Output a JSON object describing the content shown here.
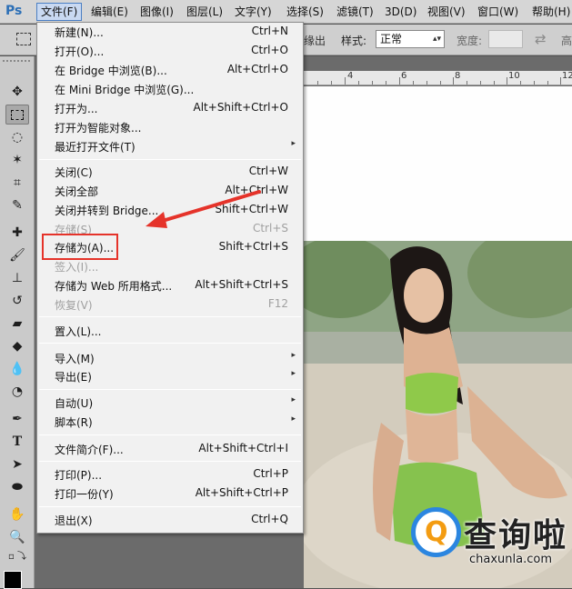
{
  "app": {
    "logo": "Ps"
  },
  "menubar": {
    "items": [
      "文件(F)",
      "编辑(E)",
      "图像(I)",
      "图层(L)",
      "文字(Y)",
      "选择(S)",
      "滤镜(T)",
      "3D(D)",
      "视图(V)",
      "窗口(W)",
      "帮助(H)"
    ]
  },
  "options": {
    "edge_text": "缘出",
    "style_label": "样式:",
    "style_value": "正常",
    "width_label": "宽度:",
    "height_label": "高"
  },
  "ruler": {
    "numbers": [
      "4",
      "6",
      "8",
      "10",
      "12"
    ]
  },
  "file_menu": {
    "items": [
      {
        "label": "新建(N)...",
        "shortcut": "Ctrl+N"
      },
      {
        "label": "打开(O)...",
        "shortcut": "Ctrl+O"
      },
      {
        "label": "在 Bridge 中浏览(B)...",
        "shortcut": "Alt+Ctrl+O"
      },
      {
        "label": "在 Mini Bridge 中浏览(G)...",
        "shortcut": ""
      },
      {
        "label": "打开为...",
        "shortcut": "Alt+Shift+Ctrl+O"
      },
      {
        "label": "打开为智能对象...",
        "shortcut": ""
      },
      {
        "label": "最近打开文件(T)",
        "shortcut": ""
      },
      {
        "label": "关闭(C)",
        "shortcut": "Ctrl+W"
      },
      {
        "label": "关闭全部",
        "shortcut": "Alt+Ctrl+W"
      },
      {
        "label": "关闭并转到 Bridge...",
        "shortcut": "Shift+Ctrl+W"
      },
      {
        "label": "存储(S)",
        "shortcut": "Ctrl+S"
      },
      {
        "label": "存储为(A)...",
        "shortcut": "Shift+Ctrl+S"
      },
      {
        "label": "签入(I)...",
        "shortcut": ""
      },
      {
        "label": "存储为 Web 所用格式...",
        "shortcut": "Alt+Shift+Ctrl+S"
      },
      {
        "label": "恢复(V)",
        "shortcut": "F12"
      },
      {
        "label": "置入(L)...",
        "shortcut": ""
      },
      {
        "label": "导入(M)",
        "shortcut": ""
      },
      {
        "label": "导出(E)",
        "shortcut": ""
      },
      {
        "label": "自动(U)",
        "shortcut": ""
      },
      {
        "label": "脚本(R)",
        "shortcut": ""
      },
      {
        "label": "文件简介(F)...",
        "shortcut": "Alt+Shift+Ctrl+I"
      },
      {
        "label": "打印(P)...",
        "shortcut": "Ctrl+P"
      },
      {
        "label": "打印一份(Y)",
        "shortcut": "Alt+Shift+Ctrl+P"
      },
      {
        "label": "退出(X)",
        "shortcut": "Ctrl+Q"
      }
    ],
    "submenu_glyph": "▸"
  },
  "watermark": {
    "brand": "查询啦",
    "url": "chaxunla.com",
    "q": "Q"
  },
  "colors": {
    "annotation_red": "#e5332a",
    "menu_highlight": "#c9d9f1"
  }
}
